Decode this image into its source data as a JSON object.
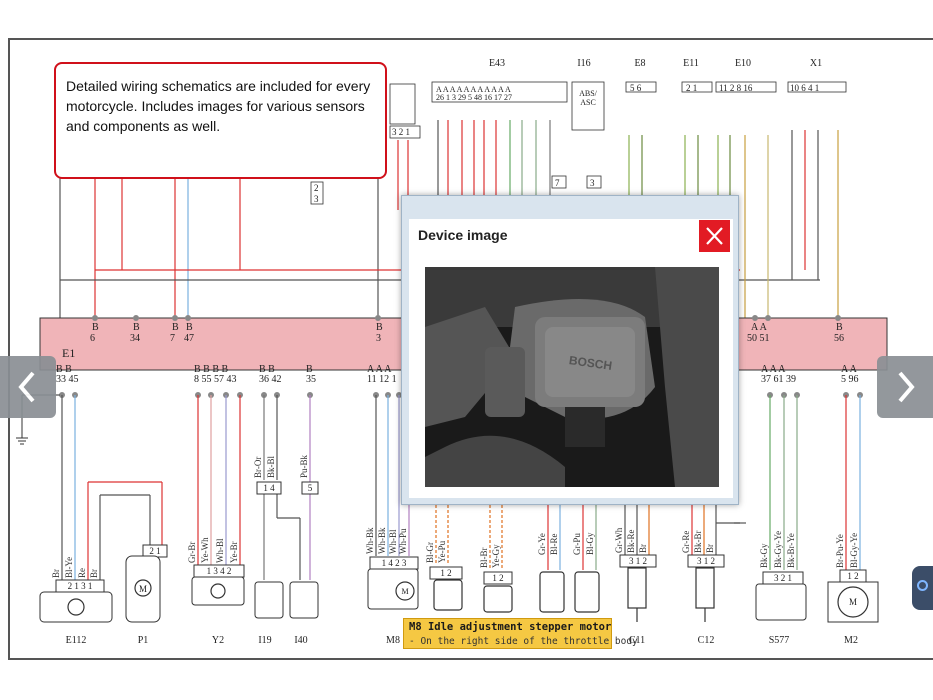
{
  "callout": {
    "text": "Detailed wiring schematics are included for every motorcycle. Includes images for various sensors and components as well."
  },
  "top_labels": [
    "E43",
    "I16",
    "E8",
    "E11",
    "E10",
    "X1"
  ],
  "ecu": {
    "name": "E1",
    "top_pin_groups": [
      "B 6",
      "B 34",
      "B 7",
      "B 47",
      "B 3",
      "A 50",
      "A 51",
      "B 56"
    ]
  },
  "bottom_components": [
    "E112",
    "P1",
    "Y2",
    "I19",
    "I40",
    "M8",
    "C11",
    "C12",
    "S577",
    "M2"
  ],
  "dialog": {
    "title": "Device image",
    "close_label": "✕",
    "photo_caption": "BOSCH"
  },
  "tooltip": {
    "title": "M8 Idle adjustment stepper motor",
    "subtitle": "- On the right side of the throttle body"
  },
  "nav": {
    "prev": "❮",
    "next": "❯"
  },
  "colors": {
    "callout_border": "#d0101a",
    "ecu_fill": "#f0b4b8",
    "close_button": "#e21b24",
    "tooltip_bg": "#f5c843"
  }
}
